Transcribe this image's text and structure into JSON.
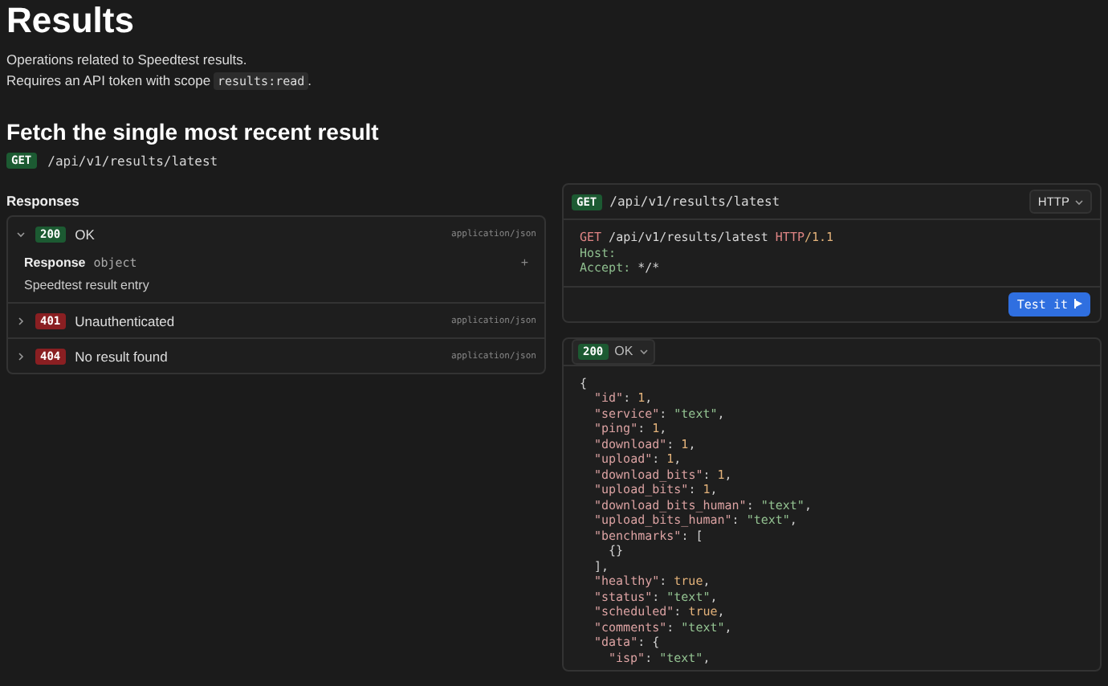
{
  "title": "Results",
  "description": [
    {
      "text": "Operations related to Speedtest results."
    },
    {
      "text": "Requires an API token with scope ",
      "code": "results:read",
      "after": "."
    }
  ],
  "operation": {
    "title": "Fetch the single most recent result",
    "method": "GET",
    "path": "/api/v1/results/latest"
  },
  "responses": {
    "heading": "Responses",
    "items": [
      {
        "status": "200",
        "label": "OK",
        "type": "application/json",
        "ok": true,
        "expanded": true,
        "schema_label": "Response",
        "schema_type": "object",
        "plus": "+",
        "description": "Speedtest result entry"
      },
      {
        "status": "401",
        "label": "Unauthenticated",
        "type": "application/json",
        "ok": false,
        "expanded": false
      },
      {
        "status": "404",
        "label": "No result found",
        "type": "application/json",
        "ok": false,
        "expanded": false
      }
    ]
  },
  "request": {
    "method": "GET",
    "path": "/api/v1/results/latest",
    "language": "HTTP",
    "button": "Test it",
    "lines": [
      [
        {
          "kind": "method",
          "text": "GET"
        },
        {
          "kind": "plain",
          "text": " /api/v1/results/latest "
        },
        {
          "kind": "method",
          "text": "HTTP"
        },
        {
          "kind": "number",
          "text": "/1.1"
        }
      ],
      [
        {
          "kind": "header",
          "text": "Host:"
        }
      ],
      [
        {
          "kind": "header",
          "text": "Accept:"
        },
        {
          "kind": "plain",
          "text": " */*"
        }
      ]
    ]
  },
  "example": {
    "status": "200",
    "label": "OK",
    "lines": [
      {
        "tokens": [
          {
            "kind": "punct",
            "text": "{"
          }
        ],
        "children": [
          {
            "tokens": [
              {
                "kind": "key",
                "text": "\"id\""
              },
              {
                "kind": "punct",
                "text": ":"
              },
              {
                "kind": "number",
                "text": "1"
              },
              {
                "kind": "punct",
                "text": ","
              }
            ]
          },
          {
            "tokens": [
              {
                "kind": "key",
                "text": "\"service\""
              },
              {
                "kind": "punct",
                "text": ":"
              },
              {
                "kind": "string",
                "text": "\"text\""
              },
              {
                "kind": "punct",
                "text": ","
              }
            ]
          },
          {
            "tokens": [
              {
                "kind": "key",
                "text": "\"ping\""
              },
              {
                "kind": "punct",
                "text": ":"
              },
              {
                "kind": "number",
                "text": "1"
              },
              {
                "kind": "punct",
                "text": ","
              }
            ]
          },
          {
            "tokens": [
              {
                "kind": "key",
                "text": "\"download\""
              },
              {
                "kind": "punct",
                "text": ":"
              },
              {
                "kind": "number",
                "text": "1"
              },
              {
                "kind": "punct",
                "text": ","
              }
            ]
          },
          {
            "tokens": [
              {
                "kind": "key",
                "text": "\"upload\""
              },
              {
                "kind": "punct",
                "text": ":"
              },
              {
                "kind": "number",
                "text": "1"
              },
              {
                "kind": "punct",
                "text": ","
              }
            ]
          },
          {
            "tokens": [
              {
                "kind": "key",
                "text": "\"download_bits\""
              },
              {
                "kind": "punct",
                "text": ":"
              },
              {
                "kind": "number",
                "text": "1"
              },
              {
                "kind": "punct",
                "text": ","
              }
            ]
          },
          {
            "tokens": [
              {
                "kind": "key",
                "text": "\"upload_bits\""
              },
              {
                "kind": "punct",
                "text": ":"
              },
              {
                "kind": "number",
                "text": "1"
              },
              {
                "kind": "punct",
                "text": ","
              }
            ]
          },
          {
            "tokens": [
              {
                "kind": "key",
                "text": "\"download_bits_human\""
              },
              {
                "kind": "punct",
                "text": ":"
              },
              {
                "kind": "string",
                "text": "\"text\""
              },
              {
                "kind": "punct",
                "text": ","
              }
            ]
          },
          {
            "tokens": [
              {
                "kind": "key",
                "text": "\"upload_bits_human\""
              },
              {
                "kind": "punct",
                "text": ":"
              },
              {
                "kind": "string",
                "text": "\"text\""
              },
              {
                "kind": "punct",
                "text": ","
              }
            ]
          },
          {
            "tokens": [
              {
                "kind": "key",
                "text": "\"benchmarks\""
              },
              {
                "kind": "punct",
                "text": ":"
              },
              {
                "kind": "punct",
                "text": "["
              }
            ],
            "children": [
              {
                "tokens": [
                  {
                    "kind": "punct",
                    "text": "{}"
                  }
                ]
              }
            ]
          },
          {
            "tokens": [
              {
                "kind": "punct",
                "text": "],"
              }
            ]
          },
          {
            "tokens": [
              {
                "kind": "key",
                "text": "\"healthy\""
              },
              {
                "kind": "punct",
                "text": ":"
              },
              {
                "kind": "number",
                "text": "true"
              },
              {
                "kind": "punct",
                "text": ","
              }
            ]
          },
          {
            "tokens": [
              {
                "kind": "key",
                "text": "\"status\""
              },
              {
                "kind": "punct",
                "text": ":"
              },
              {
                "kind": "string",
                "text": "\"text\""
              },
              {
                "kind": "punct",
                "text": ","
              }
            ]
          },
          {
            "tokens": [
              {
                "kind": "key",
                "text": "\"scheduled\""
              },
              {
                "kind": "punct",
                "text": ":"
              },
              {
                "kind": "number",
                "text": "true"
              },
              {
                "kind": "punct",
                "text": ","
              }
            ]
          },
          {
            "tokens": [
              {
                "kind": "key",
                "text": "\"comments\""
              },
              {
                "kind": "punct",
                "text": ":"
              },
              {
                "kind": "string",
                "text": "\"text\""
              },
              {
                "kind": "punct",
                "text": ","
              }
            ]
          },
          {
            "tokens": [
              {
                "kind": "key",
                "text": "\"data\""
              },
              {
                "kind": "punct",
                "text": ":"
              },
              {
                "kind": "punct",
                "text": "{"
              }
            ],
            "children": [
              {
                "tokens": [
                  {
                    "kind": "key",
                    "text": "\"isp\""
                  },
                  {
                    "kind": "punct",
                    "text": ":"
                  },
                  {
                    "kind": "string",
                    "text": "\"text\""
                  },
                  {
                    "kind": "punct",
                    "text": ","
                  }
                ]
              }
            ]
          }
        ]
      }
    ]
  }
}
